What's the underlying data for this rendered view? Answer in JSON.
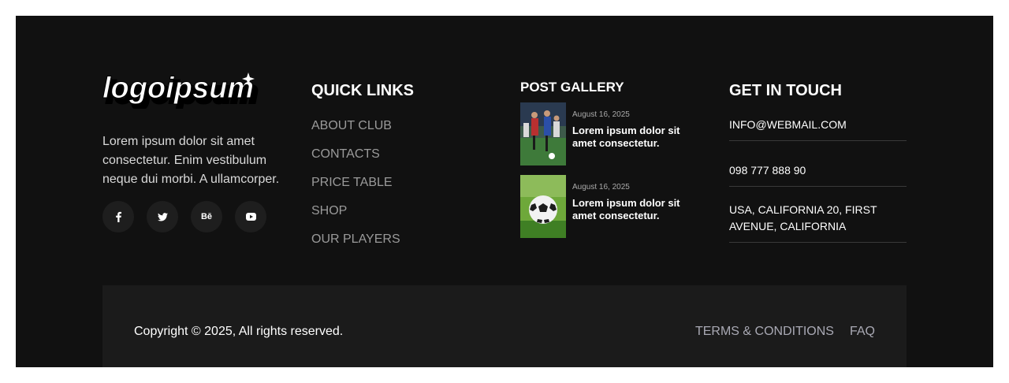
{
  "brand": {
    "logo_text": "logoipsum"
  },
  "about": {
    "text": "Lorem ipsum dolor sit amet consectetur. Enim vestibulum neque dui morbi. A ullamcorper.",
    "socials": [
      {
        "icon": "facebook-icon",
        "glyph": "f"
      },
      {
        "icon": "twitter-icon",
        "glyph": "t"
      },
      {
        "icon": "behance-icon",
        "glyph": "Bē"
      },
      {
        "icon": "youtube-icon",
        "glyph": "▶"
      }
    ]
  },
  "quick_links": {
    "title": "QUICK LINKS",
    "items": [
      "ABOUT CLUB",
      "CONTACTS",
      "PRICE TABLE",
      "SHOP",
      "OUR PLAYERS"
    ]
  },
  "gallery": {
    "title": "POST GALLERY",
    "posts": [
      {
        "date": "August 16, 2025",
        "title": "Lorem ipsum dolor sit amet consectetur.",
        "image": "soccer-players-thumbnail"
      },
      {
        "date": "August 16, 2025",
        "title": "Lorem ipsum dolor sit amet consectetur.",
        "image": "soccer-ball-thumbnail"
      }
    ]
  },
  "contact": {
    "title": "GET IN TOUCH",
    "email": "INFO@WEBMAIL.COM",
    "phone": "098 777 888 90",
    "address": "USA, CALIFORNIA 20, FIRST AVENUE, CALIFORNIA"
  },
  "bottom_bar": {
    "copyright": "Copyright © 2025, All rights reserved.",
    "links": [
      "TERMS & CONDITIONS",
      "FAQ"
    ]
  },
  "colors": {
    "footer_bg": "#111111",
    "bottom_bg": "#1b1b1b",
    "link_gray": "#9a9a9a"
  }
}
